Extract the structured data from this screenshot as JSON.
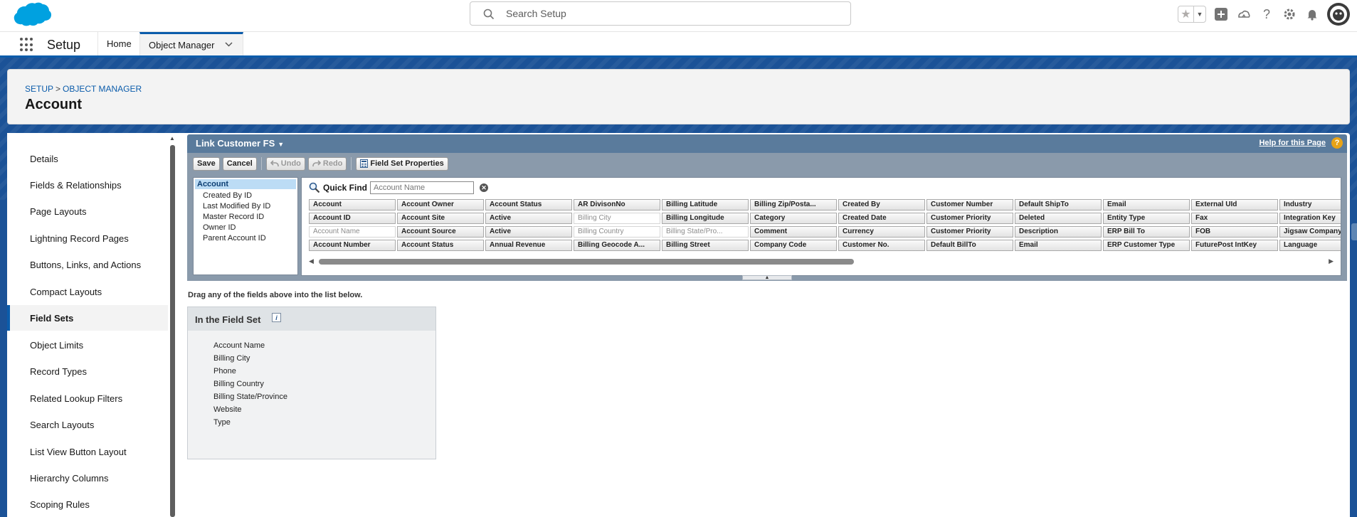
{
  "header": {
    "search_placeholder": "Search Setup"
  },
  "nav": {
    "app_name": "Setup",
    "tabs": [
      {
        "label": "Home"
      },
      {
        "label": "Object Manager"
      }
    ]
  },
  "page_header": {
    "breadcrumb": [
      "SETUP",
      "OBJECT MANAGER"
    ],
    "breadcrumb_sep": ">",
    "title": "Account"
  },
  "sidebar": {
    "items": [
      {
        "label": "Details"
      },
      {
        "label": "Fields & Relationships"
      },
      {
        "label": "Page Layouts"
      },
      {
        "label": "Lightning Record Pages"
      },
      {
        "label": "Buttons, Links, and Actions"
      },
      {
        "label": "Compact Layouts"
      },
      {
        "label": "Field Sets"
      },
      {
        "label": "Object Limits"
      },
      {
        "label": "Record Types"
      },
      {
        "label": "Related Lookup Filters"
      },
      {
        "label": "Search Layouts"
      },
      {
        "label": "List View Button Layout"
      },
      {
        "label": "Hierarchy Columns"
      },
      {
        "label": "Scoping Rules"
      }
    ],
    "active_index": 6
  },
  "field_set_editor": {
    "title": "Link Customer FS",
    "help_link": "Help for this Page",
    "help_icon": "?",
    "toolbar": {
      "save": "Save",
      "cancel": "Cancel",
      "undo": "Undo",
      "redo": "Redo",
      "properties": "Field Set Properties"
    },
    "object_tree": {
      "root": "Account",
      "children": [
        "Created By ID",
        "Last Modified By ID",
        "Master Record ID",
        "Owner ID",
        "Parent Account ID"
      ]
    },
    "quick_find": {
      "label": "Quick Find",
      "placeholder": "Account Name"
    },
    "field_rows": [
      [
        "Account",
        "Account Owner",
        "Account Status",
        "AR DivisonNo",
        "Billing Latitude",
        "Billing Zip/Posta...",
        "Created By",
        "Customer Number",
        "Default ShipTo",
        "Email",
        "External UId",
        "Industry"
      ],
      [
        "Account ID",
        "Account Site",
        "Active",
        "Billing City",
        "Billing Longitude",
        "Category",
        "Created Date",
        "Customer Priority",
        "Deleted",
        "Entity Type",
        "Fax",
        "Integration Key"
      ],
      [
        "Account Name",
        "Account Source",
        "Active",
        "Billing Country",
        "Billing State/Pro...",
        "Comment",
        "Currency",
        "Customer Priority",
        "Description",
        "ERP Bill To",
        "FOB",
        "Jigsaw Company"
      ],
      [
        "Account Number",
        "Account Status",
        "Annual Revenue",
        "Billing Geocode A...",
        "Billing Street",
        "Company Code",
        "Customer No.",
        "Default BillTo",
        "Email",
        "ERP Customer Type",
        "FuturePost IntKey",
        "Language"
      ]
    ],
    "used_fields": [
      "Account Name",
      "Billing City",
      "Billing Country",
      "Billing State/Pro..."
    ],
    "drag_instructions": "Drag any of the fields above into the list below.",
    "in_field_set": {
      "title": "In the Field Set",
      "info_icon": "i",
      "fields": [
        "Account Name",
        "Billing City",
        "Phone",
        "Billing Country",
        "Billing State/Province",
        "Website",
        "Type"
      ]
    }
  },
  "colors": {
    "brand_blue": "#0b5cab",
    "band_blue": "#1b5297",
    "editor_header": "#5a7b9c",
    "help_orange": "#e8a317"
  }
}
